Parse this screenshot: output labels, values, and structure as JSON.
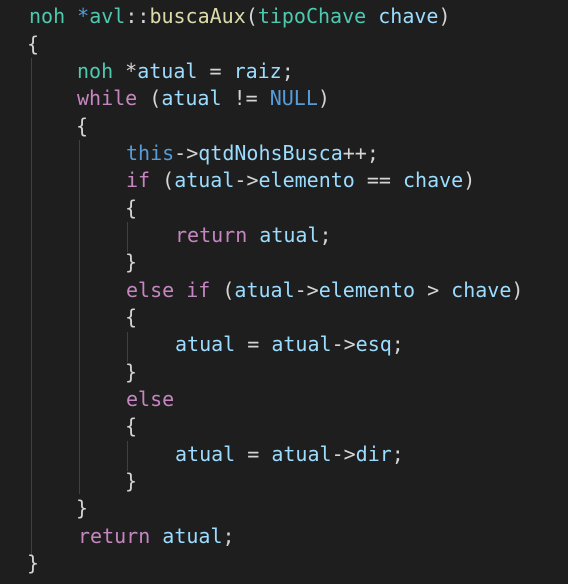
{
  "code": {
    "l1": {
      "a": "noh",
      "b": " *",
      "c": "avl",
      "d": "::",
      "e": "buscaAux",
      "f": "(",
      "g": "tipoChave",
      "h": " ",
      "i": "chave",
      "j": ")"
    },
    "l2": {
      "a": "{"
    },
    "l3": {
      "a": "noh",
      "b": " *",
      "c": "atual",
      "d": " = ",
      "e": "raiz",
      "f": ";"
    },
    "l4": {
      "a": "while",
      "b": " (",
      "c": "atual",
      "d": " != ",
      "e": "NULL",
      "f": ")"
    },
    "l5": {
      "a": "{"
    },
    "l6": {
      "a": "this",
      "b": "->",
      "c": "qtdNohsBusca",
      "d": "++;"
    },
    "l7": {
      "a": "if",
      "b": " (",
      "c": "atual",
      "d": "->",
      "e": "elemento",
      "f": " == ",
      "g": "chave",
      "h": ")"
    },
    "l8": {
      "a": "{"
    },
    "l9": {
      "a": "return",
      "b": " ",
      "c": "atual",
      "d": ";"
    },
    "l10": {
      "a": "}"
    },
    "l11": {
      "a": "else",
      "b": " ",
      "c": "if",
      "d": " (",
      "e": "atual",
      "f": "->",
      "g": "elemento",
      "h": " > ",
      "i": "chave",
      "j": ")"
    },
    "l12": {
      "a": "{"
    },
    "l13": {
      "a": "atual",
      "b": " = ",
      "c": "atual",
      "d": "->",
      "e": "esq",
      "f": ";"
    },
    "l14": {
      "a": "}"
    },
    "l15": {
      "a": "else"
    },
    "l16": {
      "a": "{"
    },
    "l17": {
      "a": "atual",
      "b": " = ",
      "c": "atual",
      "d": "->",
      "e": "dir",
      "f": ";"
    },
    "l18": {
      "a": "}"
    },
    "l19": {
      "a": "}"
    },
    "l20": {
      "a": "return",
      "b": " ",
      "c": "atual",
      "d": ";"
    },
    "l21": {
      "a": "}"
    }
  },
  "colors": {
    "background": "#1e1e1e",
    "type": "#4ec9b0",
    "variable": "#9cdcfe",
    "function": "#dcdcaa",
    "control_keyword": "#c586c0",
    "keyword": "#569cd6",
    "punctuation": "#d4d4d4",
    "indent_guide": "#404040"
  }
}
